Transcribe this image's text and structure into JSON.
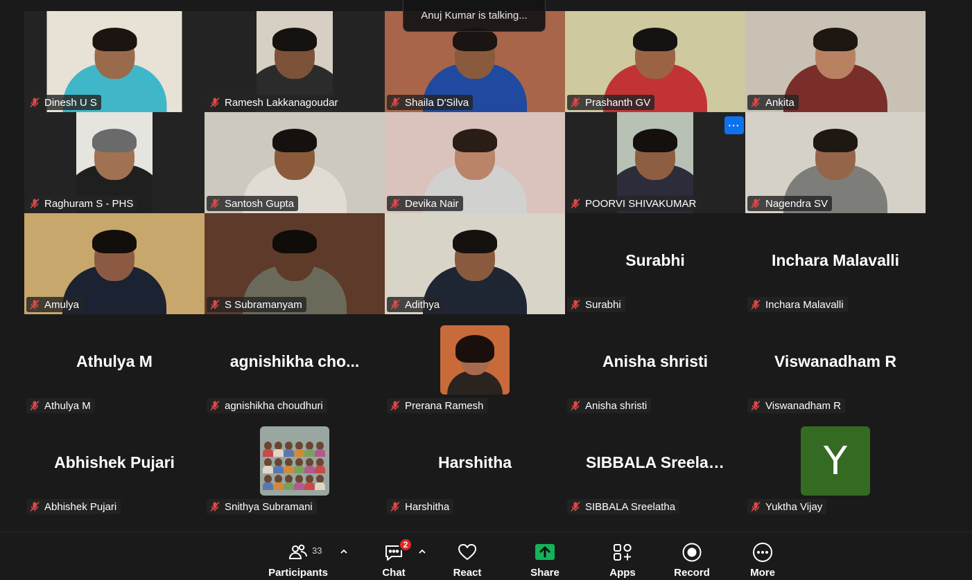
{
  "talking_indicator": "Anuj Kumar is talking...",
  "participants": [
    {
      "name": "Dinesh U S",
      "kind": "video",
      "frame": "w195",
      "bg": "#e8e2d6",
      "skin": "#9a6a4c",
      "hair": "#1c1410",
      "shirt": "#3fb7c8"
    },
    {
      "name": "Ramesh Lakkanagoudar",
      "kind": "video",
      "frame": "w110",
      "bg": "#d7cfc3",
      "skin": "#7c5238",
      "hair": "#161210",
      "shirt": "#2b2b2b"
    },
    {
      "name": "Shaila D'Silva",
      "kind": "video",
      "frame": "full",
      "bg": "#a8654a",
      "skin": "#8a5a3c",
      "hair": "#1a1512",
      "shirt": "#1f4aa0"
    },
    {
      "name": "Prashanth GV",
      "kind": "video",
      "frame": "full",
      "bg": "#cfc9a0",
      "skin": "#9a6444",
      "hair": "#151210",
      "shirt": "#c23434"
    },
    {
      "name": "Ankita",
      "kind": "video",
      "frame": "full",
      "bg": "#c9c1b4",
      "skin": "#b88262",
      "hair": "#1d1611",
      "shirt": "#7a2e2a"
    },
    {
      "name": "Raghuram S - PHS",
      "kind": "video",
      "frame": "w110",
      "bg": "#e5e4df",
      "skin": "#a07252",
      "hair": "#6a6a6a",
      "shirt": "#1f1f1f"
    },
    {
      "name": "Santosh Gupta",
      "kind": "video",
      "frame": "full",
      "bg": "#cdc9bf",
      "skin": "#8a5a3a",
      "hair": "#15110e",
      "shirt": "#e0dcd4"
    },
    {
      "name": "Devika Nair",
      "kind": "video",
      "frame": "full",
      "bg": "#d9c3bc",
      "skin": "#b98468",
      "hair": "#2a1d16",
      "shirt": "#d1d1cf"
    },
    {
      "name": "POORVI SHIVAKUMAR",
      "kind": "video",
      "frame": "w110",
      "bg": "#b7c1b4",
      "skin": "#8e5e42",
      "hair": "#14100d",
      "shirt": "#2c2c3a",
      "more": true
    },
    {
      "name": "Nagendra SV",
      "kind": "video",
      "frame": "full",
      "bg": "#d6d1c6",
      "skin": "#95654a",
      "hair": "#1f1812",
      "shirt": "#7d7d7a"
    },
    {
      "name": "Amulya",
      "kind": "video",
      "frame": "full",
      "bg": "#c7a76b",
      "skin": "#8c5a42",
      "hair": "#120e0c",
      "shirt": "#1b2232"
    },
    {
      "name": "S Subramanyam",
      "kind": "video",
      "frame": "full",
      "bg": "#5e3a2a",
      "skin": "#5e3a28",
      "hair": "#0f0c0a",
      "shirt": "#6b6a5a"
    },
    {
      "name": "Adithya",
      "kind": "video",
      "frame": "full",
      "bg": "#d9d4c8",
      "skin": "#8a5a3e",
      "hair": "#15110e",
      "shirt": "#1f2633"
    },
    {
      "name": "Surabhi",
      "display": "Surabhi",
      "kind": "name"
    },
    {
      "name": "Inchara Malavalli",
      "display": "Inchara Malavalli",
      "kind": "name"
    },
    {
      "name": "Athulya M",
      "display": "Athulya M",
      "kind": "name"
    },
    {
      "name": "agnishikha choudhuri",
      "display": "agnishikha  cho...",
      "kind": "name"
    },
    {
      "name": "Prerana Ramesh",
      "kind": "photo",
      "bg": "#c96a3a",
      "skin": "#a86a4c",
      "hair": "#1a0f0a"
    },
    {
      "name": "Anisha shristi",
      "display": "Anisha shristi",
      "kind": "name"
    },
    {
      "name": "Viswanadham R",
      "display": "Viswanadham R",
      "kind": "name"
    },
    {
      "name": "Abhishek Pujari",
      "display": "Abhishek Pujari",
      "kind": "name"
    },
    {
      "name": "Snithya Subramani",
      "kind": "group-photo",
      "bg": "#9aa7a0"
    },
    {
      "name": "Harshitha",
      "display": "Harshitha",
      "kind": "name"
    },
    {
      "name": "SIBBALA Sreelatha",
      "display": "SIBBALA  Sreelat...",
      "kind": "name"
    },
    {
      "name": "Yuktha Vijay",
      "kind": "letter",
      "letter": "Y",
      "color": "#356a22"
    }
  ],
  "toolbar": {
    "participants": {
      "label": "Participants",
      "count": "33"
    },
    "chat": {
      "label": "Chat",
      "badge": "2"
    },
    "react": {
      "label": "React"
    },
    "share": {
      "label": "Share",
      "accent": "#12b35a"
    },
    "apps": {
      "label": "Apps"
    },
    "record": {
      "label": "Record"
    },
    "more": {
      "label": "More"
    }
  },
  "colors": {
    "background": "#1a1a1a",
    "muted_mic": "#e04848"
  }
}
